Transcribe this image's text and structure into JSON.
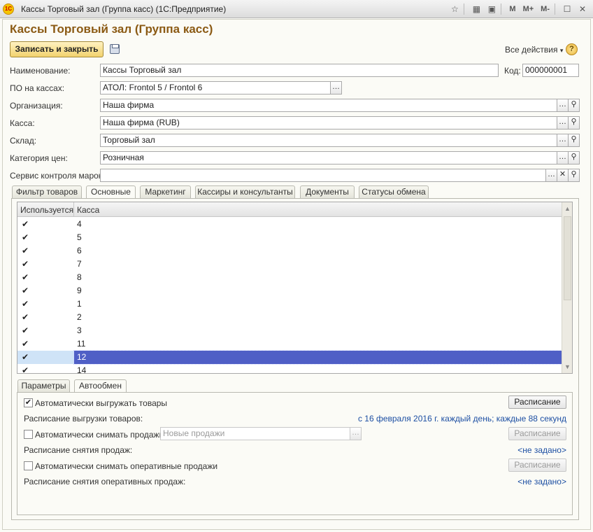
{
  "window": {
    "title": "Кассы Торговый зал (Группа касс)  (1С:Предприятие)",
    "toolbar": [
      "M",
      "M+",
      "M-"
    ]
  },
  "form": {
    "title": "Кассы Торговый зал (Группа касс)",
    "save_close_label": "Записать и закрыть",
    "all_actions_label": "Все действия",
    "help_label": "?"
  },
  "fields": {
    "name_label": "Наименование:",
    "name_value": "Кассы Торговый зал",
    "code_label": "Код:",
    "code_value": "000000001",
    "software_label": "ПО на кассах:",
    "software_value": "АТОЛ: Frontol 5 / Frontol 6",
    "org_label": "Организация:",
    "org_value": "Наша фирма",
    "cash_label": "Касса:",
    "cash_value": "Наша фирма (RUB)",
    "warehouse_label": "Склад:",
    "warehouse_value": "Торговый зал",
    "price_label": "Категория цен:",
    "price_value": "Розничная",
    "marks_label": "Сервис контроля марок:",
    "marks_value": ""
  },
  "tabs": [
    {
      "label": "Фильтр товаров"
    },
    {
      "label": "Основные"
    },
    {
      "label": "Маркетинг"
    },
    {
      "label": "Кассиры и консультанты"
    },
    {
      "label": "Документы"
    },
    {
      "label": "Статусы обмена"
    }
  ],
  "table": {
    "headers": [
      "Используется",
      "Касса"
    ],
    "rows": [
      {
        "used": "✔",
        "kassa": "4"
      },
      {
        "used": "✔",
        "kassa": "5"
      },
      {
        "used": "✔",
        "kassa": "6"
      },
      {
        "used": "✔",
        "kassa": "7"
      },
      {
        "used": "✔",
        "kassa": "8"
      },
      {
        "used": "✔",
        "kassa": "9"
      },
      {
        "used": "✔",
        "kassa": "1"
      },
      {
        "used": "✔",
        "kassa": "2"
      },
      {
        "used": "✔",
        "kassa": "3"
      },
      {
        "used": "✔",
        "kassa": "11"
      },
      {
        "used": "✔",
        "kassa": "12"
      },
      {
        "used": "✔",
        "kassa": "14"
      }
    ],
    "selected_index": 10
  },
  "subtabs": [
    {
      "label": "Параметры"
    },
    {
      "label": "Автообмен"
    }
  ],
  "autoexchange": {
    "upload_goods_label": "Автоматически выгружать товары",
    "upload_goods_checked": true,
    "schedule_button": "Расписание",
    "upload_schedule_label": "Расписание выгрузки товаров:",
    "upload_schedule_value": "с 16 февраля 2016 г. каждый день; каждые 88 секунд",
    "take_sales_label": "Автоматически снимать продажи",
    "take_sales_checked": false,
    "new_sales_placeholder": "Новые продажи",
    "take_sales_schedule_label": "Расписание снятия продаж:",
    "take_sales_schedule_value": "<не задано>",
    "take_oper_label": "Автоматически снимать оперативные продажи",
    "take_oper_checked": false,
    "take_oper_schedule_label": "Расписание снятия оперативных продаж:",
    "take_oper_schedule_value": "<не задано>"
  }
}
